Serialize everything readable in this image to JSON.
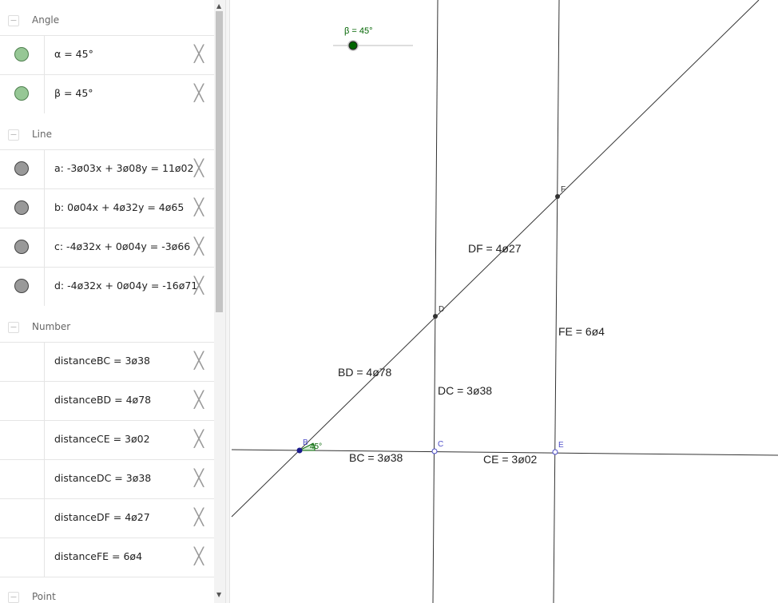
{
  "algebra": {
    "categories": {
      "angle": "Angle",
      "line": "Line",
      "number": "Number",
      "point": "Point"
    },
    "rows": [
      {
        "expr": "α = 45°",
        "marble": "green"
      },
      {
        "expr": "β = 45°",
        "marble": "green"
      },
      {
        "expr": "a: -3ø03x + 3ø08y = 11ø02",
        "marble": "gray"
      },
      {
        "expr": "b: 0ø04x + 4ø32y = 4ø65",
        "marble": "gray"
      },
      {
        "expr": "c: -4ø32x + 0ø04y = -3ø66",
        "marble": "gray"
      },
      {
        "expr": "d: -4ø32x + 0ø04y = -16ø71",
        "marble": "gray"
      },
      {
        "expr": "distanceBC = 3ø38",
        "marble": "none"
      },
      {
        "expr": "distanceBD = 4ø78",
        "marble": "none"
      },
      {
        "expr": "distanceCE = 3ø02",
        "marble": "none"
      },
      {
        "expr": "distanceDC = 3ø38",
        "marble": "none"
      },
      {
        "expr": "distanceDF = 4ø27",
        "marble": "none"
      },
      {
        "expr": "distanceFE = 6ø4",
        "marble": "none"
      }
    ],
    "collapse_symbol": "−",
    "delete_symbol": "╳"
  },
  "graphics": {
    "slider_label": "β = 45°",
    "angle_label": "45°",
    "points": {
      "B": "B",
      "C": "C",
      "D": "D",
      "E": "E",
      "F": "F"
    },
    "segments": {
      "DF": "DF = 4ø27",
      "FE": "FE = 6ø4",
      "BD": "BD = 4ø78",
      "DC": "DC = 3ø38",
      "BC": "BC = 3ø38",
      "CE": "CE = 3ø02"
    },
    "colors": {
      "line": "#333333",
      "point": "#333333",
      "blue_point": "#4c4cc8",
      "angle": "#006400",
      "slider": "#006400"
    }
  }
}
